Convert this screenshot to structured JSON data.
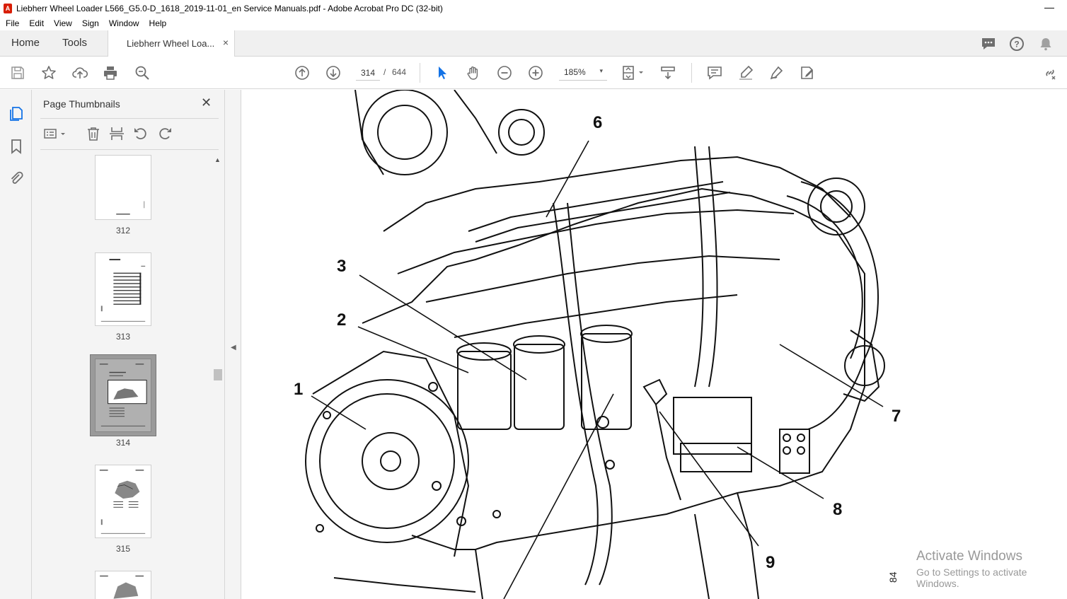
{
  "window": {
    "title": "Liebherr Wheel Loader L566_G5.0-D_1618_2019-11-01_en Service Manuals.pdf - Adobe Acrobat Pro DC (32-bit)",
    "minimize_glyph": "—"
  },
  "menu": [
    "File",
    "Edit",
    "View",
    "Sign",
    "Window",
    "Help"
  ],
  "tabs": {
    "home": "Home",
    "tools": "Tools",
    "document": "Liebherr Wheel Loa...",
    "close_glyph": "×"
  },
  "toolbar": {
    "current_page": "314",
    "page_separator": "/",
    "total_pages": "644",
    "zoom": "185%",
    "zoom_arrow": "▾"
  },
  "thumbnails_panel": {
    "title": "Page Thumbnails",
    "close_glyph": "✕",
    "pages": [
      {
        "label": "312",
        "selected": false
      },
      {
        "label": "313",
        "selected": false
      },
      {
        "label": "314",
        "selected": true
      },
      {
        "label": "315",
        "selected": false
      }
    ],
    "scroll_up_glyph": "▲"
  },
  "collapse_glyph": "◀",
  "document": {
    "callouts": [
      "1",
      "2",
      "3",
      "6",
      "7",
      "8",
      "9"
    ],
    "figure_number": "84"
  },
  "watermark": {
    "line1": "Activate Windows",
    "line2": "Go to Settings to activate Windows."
  },
  "colors": {
    "accent_select": "#1473e6",
    "icon_gray": "#6e6e6e",
    "panel_bg": "#f4f4f4"
  }
}
